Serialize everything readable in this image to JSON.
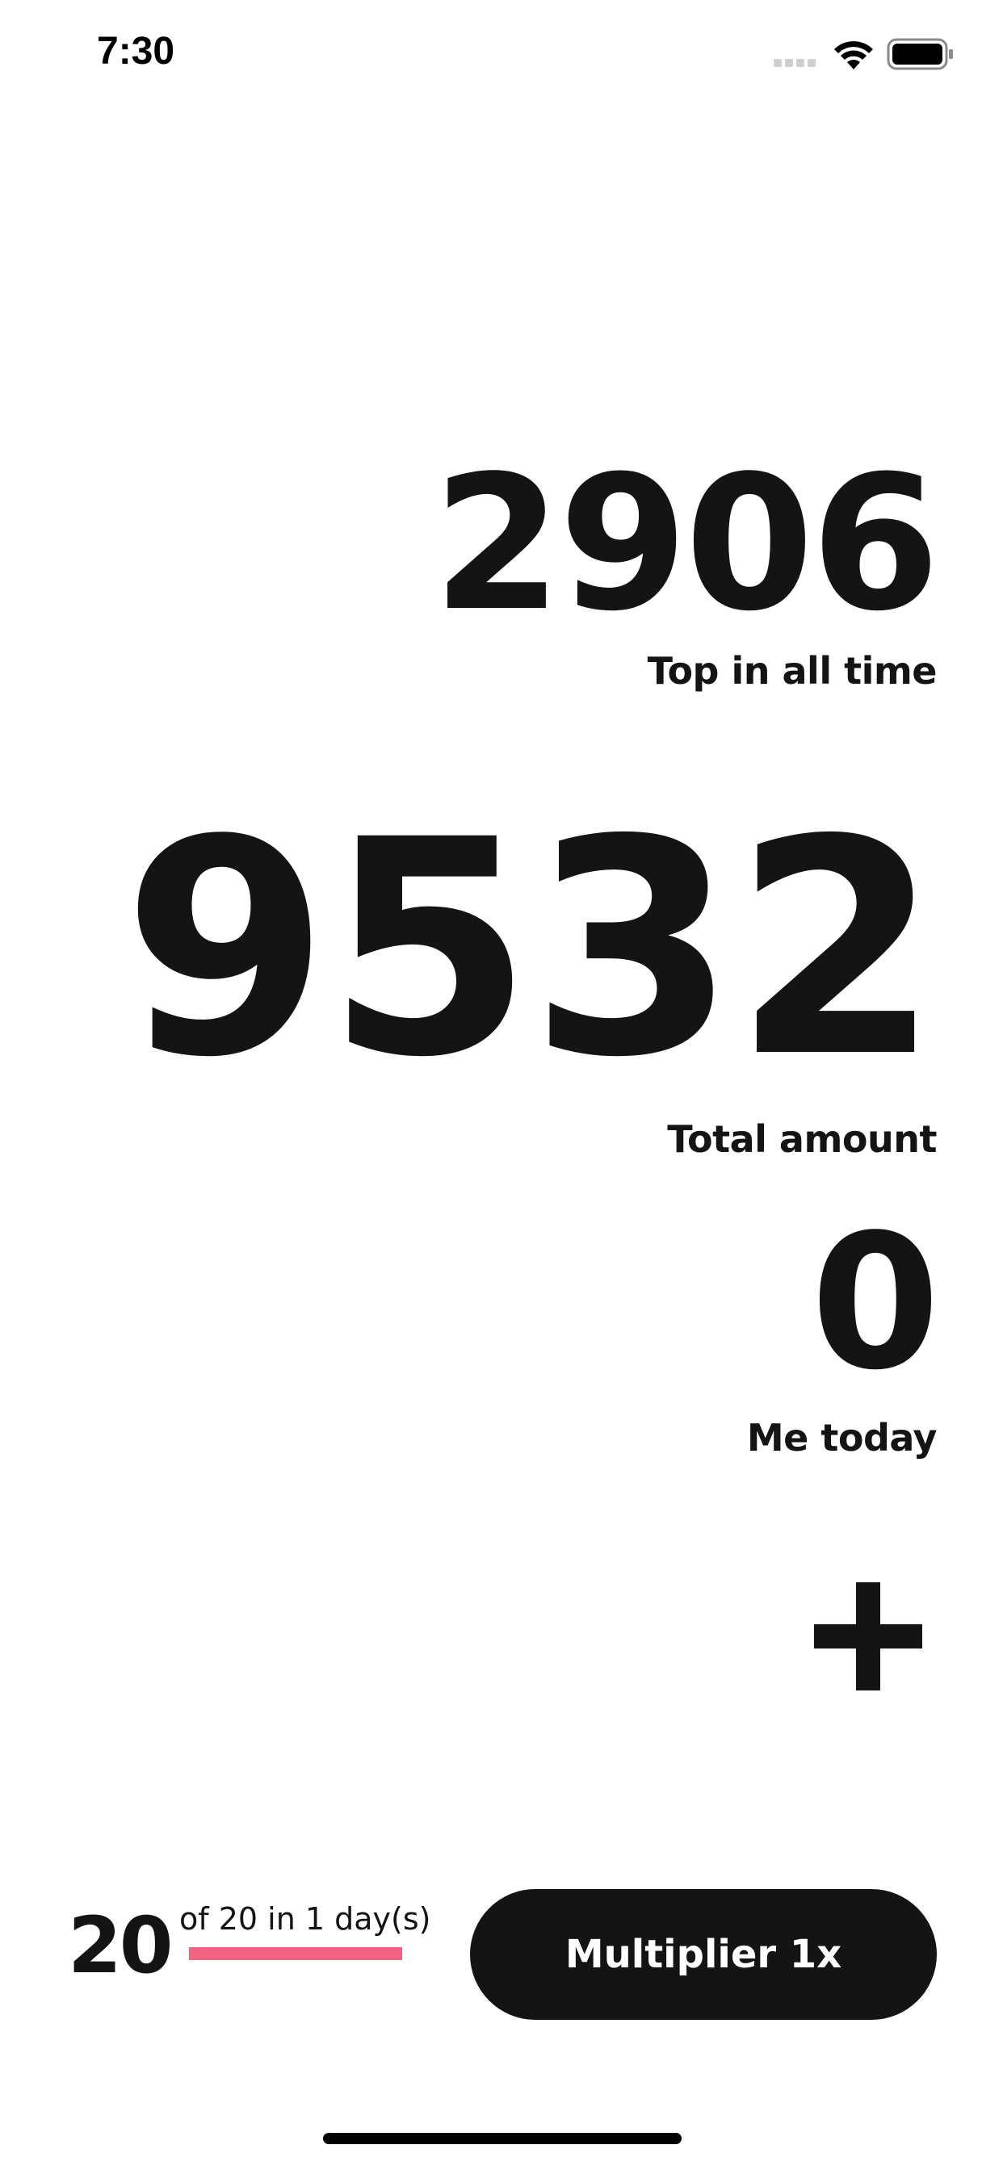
{
  "status_bar": {
    "time": "7:30",
    "icons": [
      "signal-icon",
      "wifi-icon",
      "battery-icon"
    ]
  },
  "stats": {
    "top_all_time": {
      "value": "2906",
      "label": "Top in all time"
    },
    "total_amount": {
      "value": "9532",
      "label": "Total amount"
    },
    "me_today": {
      "value": "0",
      "label": "Me today"
    }
  },
  "add_button": {
    "icon": "plus-icon"
  },
  "progress": {
    "count": "20",
    "caption": "of 20 in 1 day(s)",
    "fraction": 1.0
  },
  "multiplier_button": {
    "label": "Multiplier 1x"
  },
  "colors": {
    "text": "#141414",
    "accent": "#f06383",
    "background": "#ffffff"
  }
}
